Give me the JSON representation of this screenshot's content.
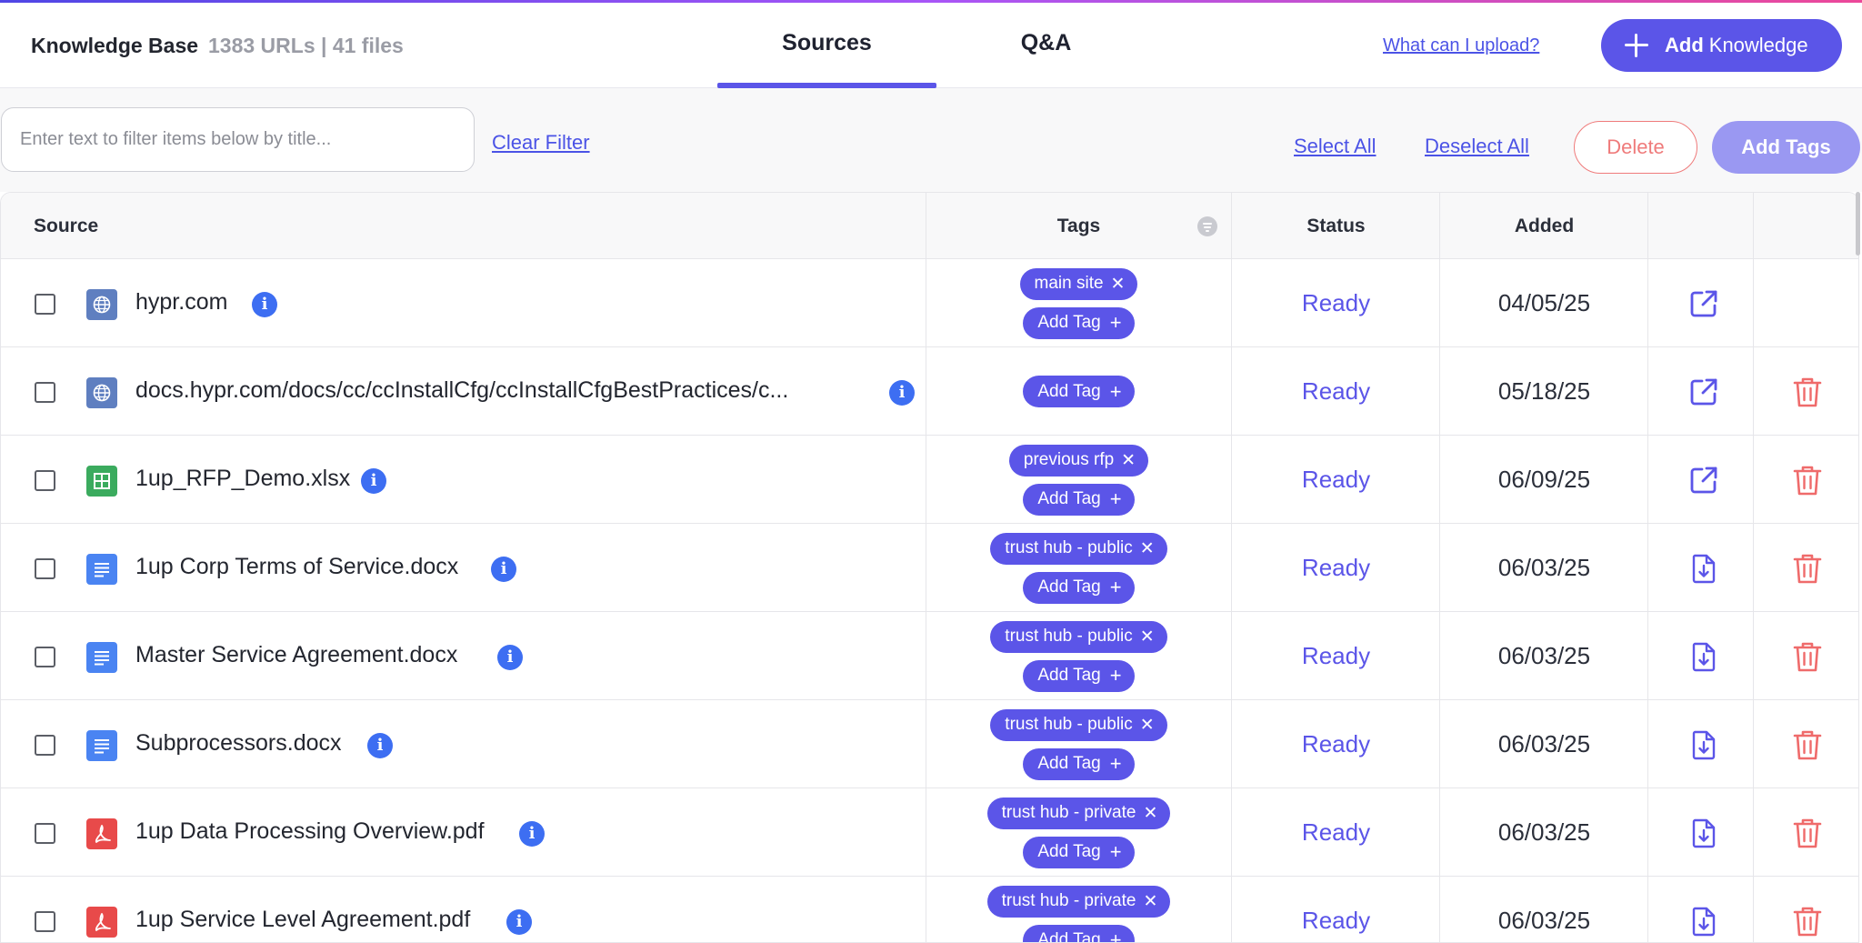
{
  "header": {
    "title": "Knowledge Base",
    "counts": "1383 URLs | 41 files",
    "tabs": [
      {
        "label": "Sources",
        "active": true
      },
      {
        "label": "Q&A",
        "active": false
      }
    ],
    "help_link": "What can I upload?",
    "add_button": {
      "bold": "Add",
      "rest": "Knowledge"
    }
  },
  "filter": {
    "placeholder": "Enter text to filter items below by title...",
    "clear_label": "Clear Filter",
    "select_all": "Select All",
    "deselect_all": "Deselect All",
    "delete": "Delete",
    "add_tags": "Add Tags"
  },
  "table": {
    "columns": {
      "source": "Source",
      "tags": "Tags",
      "status": "Status",
      "added": "Added"
    },
    "add_tag_label": "Add Tag",
    "rows": [
      {
        "icon": "web",
        "name": "hypr.com",
        "tags": [
          "main site"
        ],
        "status": "Ready",
        "added": "04/05/25",
        "action": "external-link-icon",
        "deletable": false
      },
      {
        "icon": "web",
        "name": "docs.hypr.com/docs/cc/ccInstallCfg/ccInstallCfgBestPractices/c...",
        "tags": [],
        "status": "Ready",
        "added": "05/18/25",
        "action": "external-link-icon",
        "deletable": true
      },
      {
        "icon": "sheet",
        "name": "1up_RFP_Demo.xlsx",
        "tags": [
          "previous rfp"
        ],
        "status": "Ready",
        "added": "06/09/25",
        "action": "external-link-icon",
        "deletable": true
      },
      {
        "icon": "doc",
        "name": "1up Corp Terms of Service.docx",
        "tags": [
          "trust hub - public"
        ],
        "status": "Ready",
        "added": "06/03/25",
        "action": "download-file-icon",
        "deletable": true
      },
      {
        "icon": "doc",
        "name": "Master Service Agreement.docx",
        "tags": [
          "trust hub - public"
        ],
        "status": "Ready",
        "added": "06/03/25",
        "action": "download-file-icon",
        "deletable": true
      },
      {
        "icon": "doc",
        "name": "Subprocessors.docx",
        "tags": [
          "trust hub - public"
        ],
        "status": "Ready",
        "added": "06/03/25",
        "action": "download-file-icon",
        "deletable": true
      },
      {
        "icon": "pdf",
        "name": "1up Data Processing Overview.pdf",
        "tags": [
          "trust hub - private"
        ],
        "status": "Ready",
        "added": "06/03/25",
        "action": "download-file-icon",
        "deletable": true
      },
      {
        "icon": "pdf",
        "name": "1up Service Level Agreement.pdf",
        "tags": [
          "trust hub - private"
        ],
        "status": "Ready",
        "added": "06/03/25",
        "action": "download-file-icon",
        "deletable": true
      }
    ]
  },
  "colors": {
    "accent": "#5b55e8",
    "danger": "#ef7b7b",
    "link": "#4b53e6"
  }
}
